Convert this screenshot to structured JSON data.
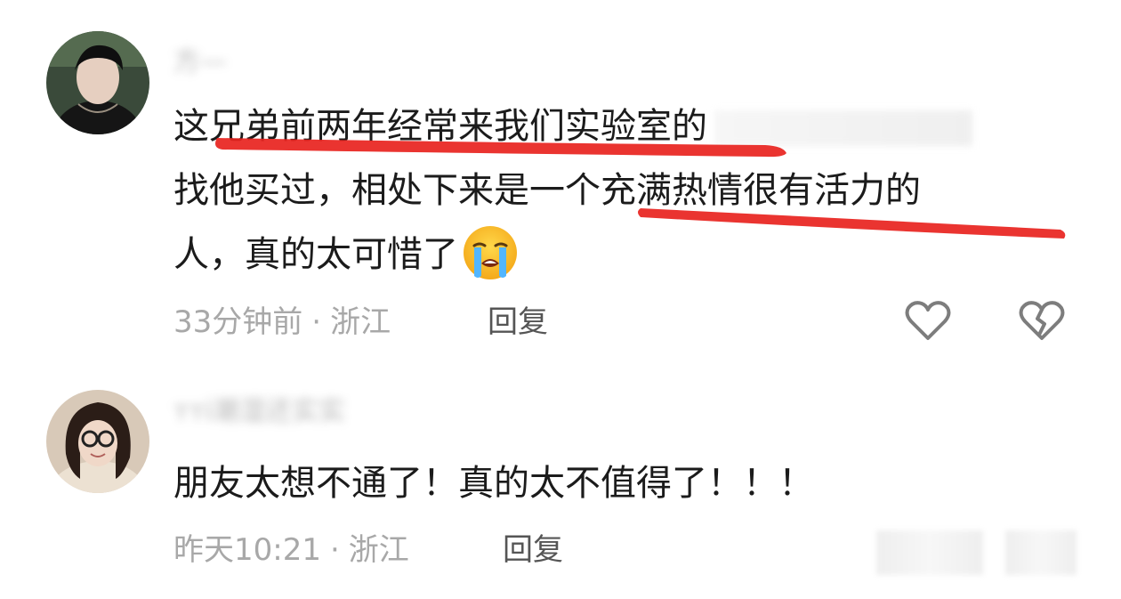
{
  "comments": [
    {
      "username": "方—",
      "lines": [
        "这兄弟前两年经常来我们实验室的",
        "找他买过，相处下来是一个充满热情很有活力的",
        "人，真的太可惜了"
      ],
      "emoji": "loudly-crying-face",
      "time": "33分钟前",
      "location": "浙江",
      "reply_label": "回复",
      "icons": [
        "heart-outline-icon",
        "broken-heart-outline-icon"
      ],
      "highlight_color": "#e8231e"
    },
    {
      "username": "тті潮湿还实实",
      "lines": [
        "朋友太想不通了！真的太不值得了！！！"
      ],
      "time": "昨天10:21",
      "location": "浙江",
      "reply_label": "回复"
    }
  ],
  "separator": "·"
}
